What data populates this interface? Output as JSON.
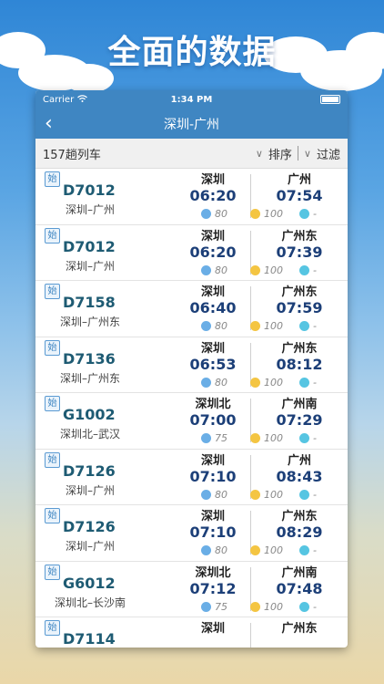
{
  "promo_title": "全面的数据",
  "status_bar": {
    "carrier": "Carrier",
    "time": "1:34 PM"
  },
  "nav": {
    "back_icon": "‹",
    "title": "深圳-广州"
  },
  "filter_bar": {
    "count": "157趟列车",
    "sort_label": "排序",
    "filter_label": "过滤",
    "chevron": "∨"
  },
  "start_badge": "始",
  "trains": [
    {
      "number": "D7012",
      "route": "深圳–广州",
      "dep_station": "深圳",
      "dep_time": "06:20",
      "arr_station": "广州",
      "arr_time": "07:54",
      "seat_a": "80",
      "seat_b": "100",
      "seat_c": "-"
    },
    {
      "number": "D7012",
      "route": "深圳–广州",
      "dep_station": "深圳",
      "dep_time": "06:20",
      "arr_station": "广州东",
      "arr_time": "07:39",
      "seat_a": "80",
      "seat_b": "100",
      "seat_c": "-"
    },
    {
      "number": "D7158",
      "route": "深圳–广州东",
      "dep_station": "深圳",
      "dep_time": "06:40",
      "arr_station": "广州东",
      "arr_time": "07:59",
      "seat_a": "80",
      "seat_b": "100",
      "seat_c": "-"
    },
    {
      "number": "D7136",
      "route": "深圳–广州东",
      "dep_station": "深圳",
      "dep_time": "06:53",
      "arr_station": "广州东",
      "arr_time": "08:12",
      "seat_a": "80",
      "seat_b": "100",
      "seat_c": "-"
    },
    {
      "number": "G1002",
      "route": "深圳北–武汉",
      "dep_station": "深圳北",
      "dep_time": "07:00",
      "arr_station": "广州南",
      "arr_time": "07:29",
      "seat_a": "75",
      "seat_b": "100",
      "seat_c": "-"
    },
    {
      "number": "D7126",
      "route": "深圳–广州",
      "dep_station": "深圳",
      "dep_time": "07:10",
      "arr_station": "广州",
      "arr_time": "08:43",
      "seat_a": "80",
      "seat_b": "100",
      "seat_c": "-"
    },
    {
      "number": "D7126",
      "route": "深圳–广州",
      "dep_station": "深圳",
      "dep_time": "07:10",
      "arr_station": "广州东",
      "arr_time": "08:29",
      "seat_a": "80",
      "seat_b": "100",
      "seat_c": "-"
    },
    {
      "number": "G6012",
      "route": "深圳北–长沙南",
      "dep_station": "深圳北",
      "dep_time": "07:12",
      "arr_station": "广州南",
      "arr_time": "07:48",
      "seat_a": "75",
      "seat_b": "100",
      "seat_c": "-"
    },
    {
      "number": "D7114",
      "route": "",
      "dep_station": "深圳",
      "dep_time": "",
      "arr_station": "广州东",
      "arr_time": "",
      "seat_a": "",
      "seat_b": "",
      "seat_c": ""
    }
  ]
}
